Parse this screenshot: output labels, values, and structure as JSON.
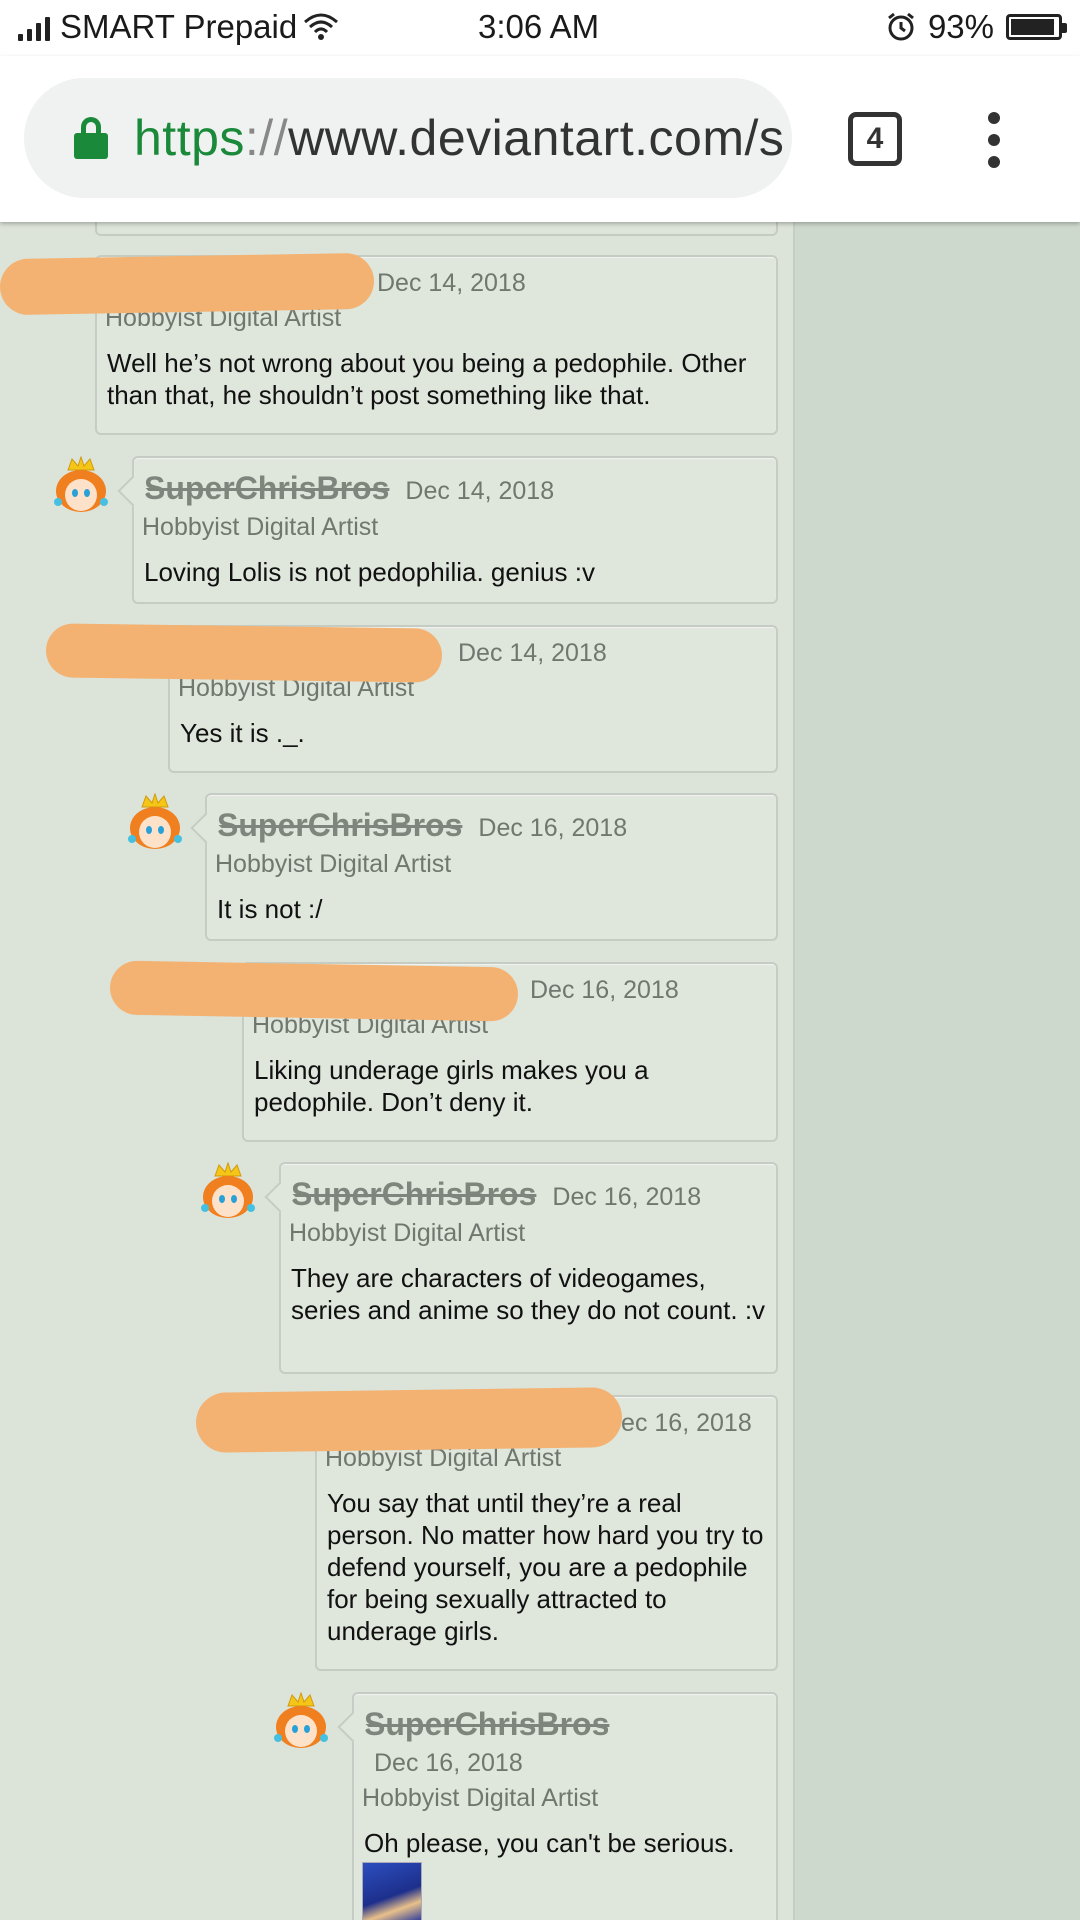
{
  "status_bar": {
    "carrier": "SMART Prepaid",
    "time": "3:06 AM",
    "battery": "93%",
    "battery_level": 0.93
  },
  "browser": {
    "url_scheme": "https",
    "url_sep": "://",
    "url_rest": "www.deviantart.com/s",
    "tab_count": "4"
  },
  "comments": [
    {
      "user": "",
      "date": "Dec 14, 2018",
      "role": "Hobbyist Digital Artist",
      "text": "Well he’s not wrong about you being a pedophile. Other than that, he shouldn’t post something like that."
    },
    {
      "user": "SuperChrisBros",
      "date": "Dec 14, 2018",
      "role": "Hobbyist Digital Artist",
      "text": "Loving Lolis is not pedophilia. genius :v"
    },
    {
      "user": "",
      "date": "Dec 14, 2018",
      "role": "Hobbyist Digital Artist",
      "text": "Yes it is ._."
    },
    {
      "user": "SuperChrisBros",
      "date": "Dec 16, 2018",
      "role": "Hobbyist Digital Artist",
      "text": "It is not :/"
    },
    {
      "user": "",
      "date": "Dec 16, 2018",
      "role": "Hobbyist Digital Artist",
      "text": "Liking underage girls makes you a pedophile. Don’t deny it."
    },
    {
      "user": "SuperChrisBros",
      "date": "Dec 16, 2018",
      "role": "Hobbyist Digital Artist",
      "text": "They are characters of videogames, series and anime so they do not count. :v"
    },
    {
      "user": "",
      "date": "Dec 16, 2018",
      "role": "Hobbyist Digital Artist",
      "text": "You say that until they’re a real person. No matter how hard you try to defend yourself, you are a pedophile for being sexually attracted to underage girls."
    },
    {
      "user": "SuperChrisBros",
      "date": "Dec 16, 2018",
      "role": "Hobbyist Digital Artist",
      "text": "Oh please, you can't be serious."
    }
  ],
  "icons": {
    "avatar": "princess-daisy-avatar-icon",
    "lock": "lock-icon",
    "menu": "overflow-menu-icon",
    "wifi": "wifi-icon",
    "alarm": "alarm-icon"
  },
  "colors": {
    "page_bg": "#dce3d9",
    "secure_green": "#1a8a3a",
    "redaction": "#f3b272"
  }
}
